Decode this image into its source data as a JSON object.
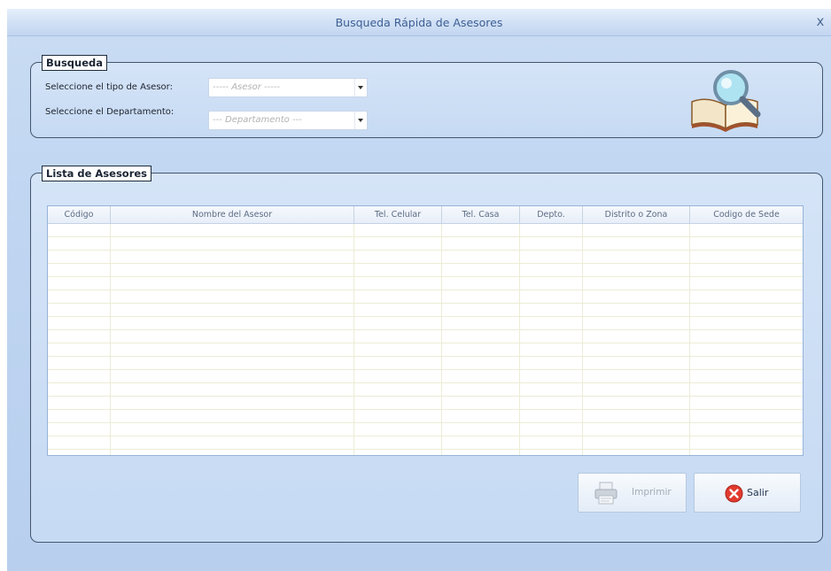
{
  "window": {
    "title": "Busqueda Rápida de Asesores",
    "close_glyph": "x"
  },
  "search_group": {
    "legend": "Busqueda",
    "tipo_label": "Seleccione el tipo de Asesor:",
    "tipo_value": "----- Asesor -----",
    "depto_label": "Seleccione el Departamento:",
    "depto_value": "--- Departamento ---",
    "icon": "book-magnifier-icon"
  },
  "list_group": {
    "legend": "Lista de Asesores",
    "columns": [
      "Código",
      "Nombre del Asesor",
      "Tel. Celular",
      "Tel. Casa",
      "Depto.",
      "Distrito o Zona",
      "Codigo de Sede"
    ],
    "rows": []
  },
  "buttons": {
    "print_label": "Imprimir",
    "print_icon": "printer-icon",
    "exit_label": "Salir",
    "exit_icon": "close-circle-icon"
  },
  "colors": {
    "title_text": "#3c5e95",
    "exit_icon": "#e23a2e"
  }
}
